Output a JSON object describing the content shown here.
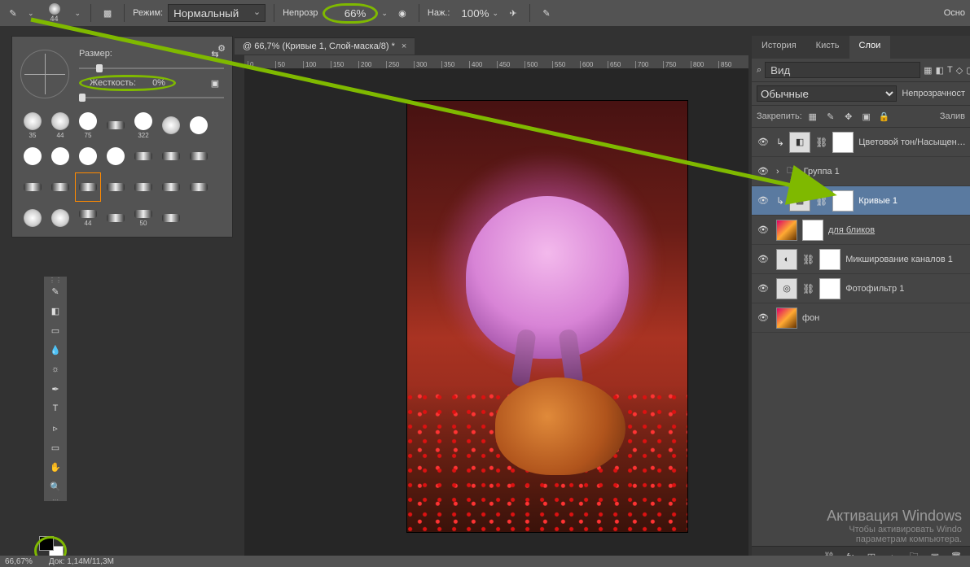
{
  "options_bar": {
    "brush_size": "44",
    "mode_label": "Режим:",
    "mode_value": "Нормальный",
    "opacity_label": "Непрозр",
    "opacity_value": "66%",
    "flow_label": "Наж.:",
    "flow_value": "100%",
    "right_label": "Осно"
  },
  "brush_popover": {
    "size_label": "Размер:",
    "hardness_label": "Жесткость:",
    "hardness_value": "0%",
    "row1": [
      {
        "v": "35",
        "k": "round"
      },
      {
        "v": "44",
        "k": "round"
      },
      {
        "v": "75",
        "k": "hard"
      },
      {
        "v": "",
        "k": "flat"
      },
      {
        "v": "322",
        "k": "hard"
      }
    ],
    "row2": [
      {
        "v": "",
        "k": "round"
      },
      {
        "v": "",
        "k": "hard"
      },
      {
        "v": "",
        "k": "hard"
      },
      {
        "v": "",
        "k": "hard"
      },
      {
        "v": "",
        "k": "hard"
      },
      {
        "v": "",
        "k": "hard"
      }
    ],
    "row3": [
      {
        "v": "",
        "k": "flat"
      },
      {
        "v": "",
        "k": "flat"
      },
      {
        "v": "",
        "k": "flat"
      },
      {
        "v": "",
        "k": "flat"
      },
      {
        "v": "",
        "k": "flat"
      },
      {
        "v": "",
        "k": "flat",
        "sel": true
      }
    ],
    "row4": [
      {
        "v": "",
        "k": "flat"
      },
      {
        "v": "",
        "k": "flat"
      },
      {
        "v": "",
        "k": "flat"
      },
      {
        "v": "",
        "k": "flat"
      },
      {
        "v": "",
        "k": "round"
      },
      {
        "v": "",
        "k": "round"
      }
    ],
    "row5": [
      {
        "v": "44",
        "k": "flat"
      },
      {
        "v": "",
        "k": "flat"
      },
      {
        "v": "50",
        "k": "flat"
      },
      {
        "v": "",
        "k": "flat"
      }
    ]
  },
  "doc_tab": "@ 66,7% (Кривые 1, Слой-маска/8) *",
  "ruler_marks": [
    "0",
    "50",
    "100",
    "150",
    "200",
    "250",
    "300",
    "350",
    "400",
    "450",
    "500",
    "550",
    "600",
    "650",
    "700",
    "750",
    "800",
    "850"
  ],
  "panels": {
    "tabs": [
      "История",
      "Кисть",
      "Слои"
    ],
    "active_tab": 2,
    "search_kind": "Вид",
    "blend_mode": "Обычные",
    "opacity_label": "Непрозрачност",
    "lock_label": "Закрепить:",
    "fill_label": "Залив",
    "layers": [
      {
        "name": "Цветовой тон/Насыщенность",
        "adj": "◧",
        "mask": true,
        "link": true,
        "clip": true
      },
      {
        "name": "Группа 1",
        "group": true
      },
      {
        "name": "Кривые 1",
        "adj": "▩",
        "mask": true,
        "link": true,
        "clip": true,
        "active": true
      },
      {
        "name": "для бликов",
        "img": true,
        "mask": true,
        "underline": true
      },
      {
        "name": "Микширование каналов 1",
        "adj": "◐",
        "mask": true,
        "link": true
      },
      {
        "name": "Фотофильтр 1",
        "adj": "◎",
        "mask": true,
        "link": true
      },
      {
        "name": "фон",
        "img": true
      }
    ]
  },
  "windows_overlay": {
    "line1": "Активация Windows",
    "line2": "Чтобы активировать Windo",
    "line3": "параметрам компьютера."
  },
  "status": {
    "zoom": "66,67%",
    "doc": "Док: 1,14M/11,3M"
  },
  "icons": {
    "search": "⌕",
    "gear": "⚙",
    "brush": "✎",
    "eraser": "▱",
    "gradient": "▭",
    "blur": "◌",
    "dodge": "☼",
    "pen": "✒",
    "type": "T",
    "path": "▹",
    "rect": "▭",
    "hand": "✋",
    "zoom": "🔍",
    "eye": "👁",
    "link": "⛓",
    "fx": "fx",
    "mask": "◰",
    "adj": "◐",
    "folder": "🗀",
    "new": "▣",
    "trash": "🗑",
    "clip": "↳",
    "chev": "⌄",
    "lock": "🔒",
    "ring": "◯",
    "bold": "T",
    "brushbar": "✎",
    "airbrush": "✈",
    "pressure": "◉",
    "swap": "⤭",
    "filter_pixel": "▦",
    "filter_adj": "◧",
    "filter_type": "T",
    "filter_shape": "◇",
    "filter_smart": "▢"
  }
}
